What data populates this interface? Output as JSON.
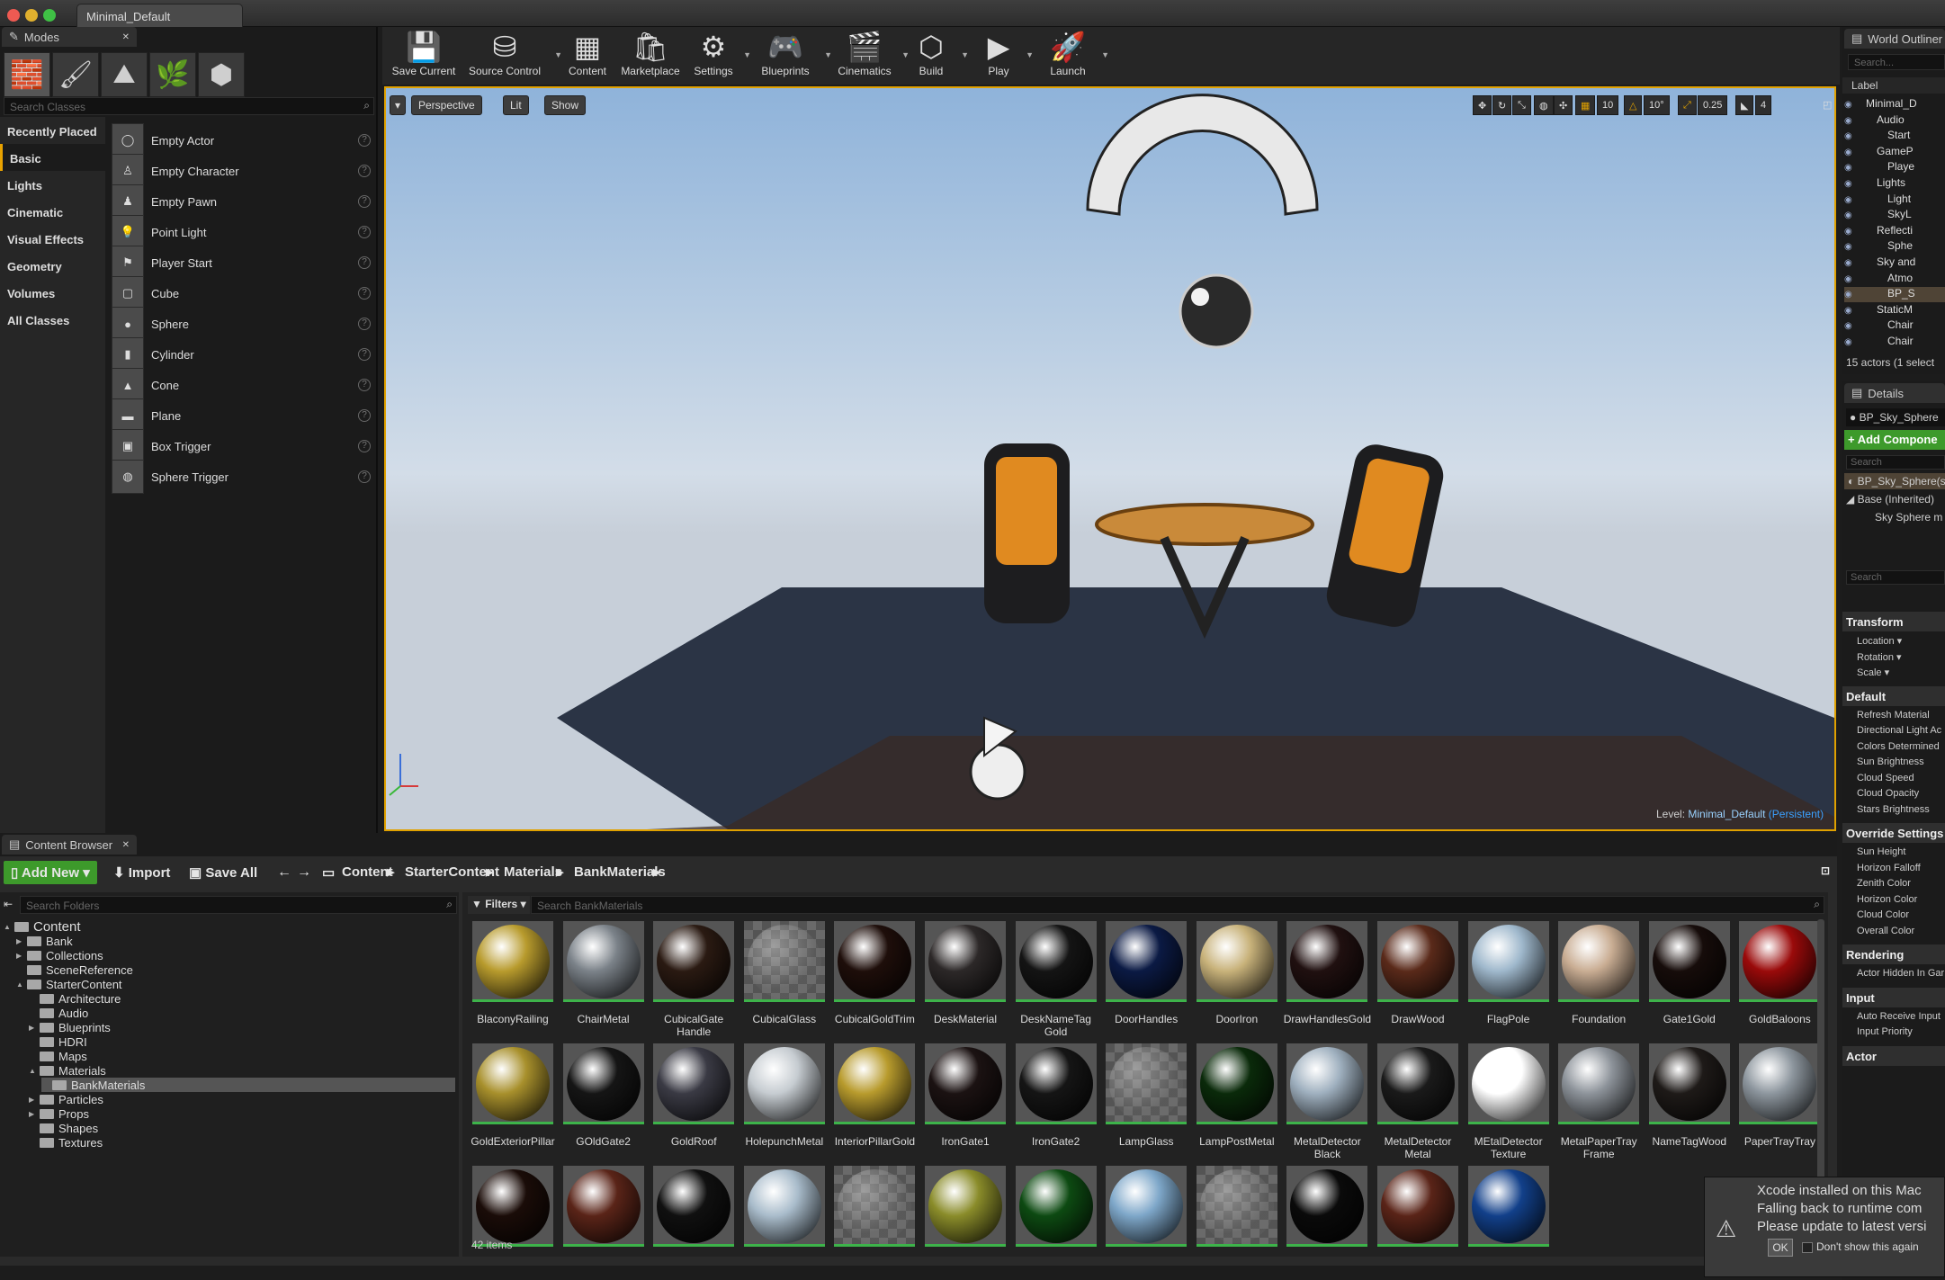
{
  "window": {
    "title": "Minimal_Default"
  },
  "modes": {
    "tab_label": "Modes",
    "search_placeholder": "Search Classes",
    "categories": [
      "Recently Placed",
      "Basic",
      "Lights",
      "Cinematic",
      "Visual Effects",
      "Geometry",
      "Volumes",
      "All Classes"
    ],
    "active_category": "Basic",
    "items": [
      "Empty Actor",
      "Empty Character",
      "Empty Pawn",
      "Point Light",
      "Player Start",
      "Cube",
      "Sphere",
      "Cylinder",
      "Cone",
      "Plane",
      "Box Trigger",
      "Sphere Trigger"
    ]
  },
  "toolbar": {
    "buttons": [
      "Save Current",
      "Source Control",
      "Content",
      "Marketplace",
      "Settings",
      "Blueprints",
      "Cinematics",
      "Build",
      "Play",
      "Launch"
    ]
  },
  "viewport": {
    "perspective": "Perspective",
    "lit": "Lit",
    "show": "Show",
    "grid_snap": "10",
    "rot_snap": "10°",
    "scale_snap": "0.25",
    "cam_speed": "4",
    "level_label": "Level:",
    "level_name": "Minimal_Default",
    "level_suffix": "(Persistent)"
  },
  "content_browser": {
    "tab_label": "Content Browser",
    "add_new": "Add New",
    "import": "Import",
    "save_all": "Save All",
    "path": [
      "Content",
      "StarterContent",
      "Materials",
      "BankMaterials"
    ],
    "search_folders_placeholder": "Search Folders",
    "filters_label": "Filters",
    "search_assets_placeholder": "Search BankMaterials",
    "folders": [
      {
        "name": "Content",
        "depth": 0,
        "arrow": "▲"
      },
      {
        "name": "Bank",
        "depth": 1,
        "arrow": "▶"
      },
      {
        "name": "Collections",
        "depth": 1,
        "arrow": "▶"
      },
      {
        "name": "SceneReference",
        "depth": 1,
        "arrow": ""
      },
      {
        "name": "StarterContent",
        "depth": 1,
        "arrow": "▲"
      },
      {
        "name": "Architecture",
        "depth": 2,
        "arrow": ""
      },
      {
        "name": "Audio",
        "depth": 2,
        "arrow": ""
      },
      {
        "name": "Blueprints",
        "depth": 2,
        "arrow": "▶"
      },
      {
        "name": "HDRI",
        "depth": 2,
        "arrow": ""
      },
      {
        "name": "Maps",
        "depth": 2,
        "arrow": ""
      },
      {
        "name": "Materials",
        "depth": 2,
        "arrow": "▲"
      },
      {
        "name": "BankMaterials",
        "depth": 3,
        "arrow": ""
      },
      {
        "name": "Particles",
        "depth": 2,
        "arrow": "▶"
      },
      {
        "name": "Props",
        "depth": 2,
        "arrow": "▶"
      },
      {
        "name": "Shapes",
        "depth": 2,
        "arrow": ""
      },
      {
        "name": "Textures",
        "depth": 2,
        "arrow": ""
      }
    ],
    "assets": [
      {
        "name": "BlaconyRailing",
        "color": "#b89b2d"
      },
      {
        "name": "ChairMetal",
        "color": "#7b8289"
      },
      {
        "name": "CubicalGate Handle",
        "color": "#2a1a12"
      },
      {
        "name": "CubicalGlass",
        "color": "checker"
      },
      {
        "name": "CubicalGoldTrim",
        "color": "#1e0e0a"
      },
      {
        "name": "DeskMaterial",
        "color": "#2c2828"
      },
      {
        "name": "DeskNameTag Gold",
        "color": "#141414"
      },
      {
        "name": "DoorHandles",
        "color": "#0b1a44"
      },
      {
        "name": "DoorIron",
        "color": "#c8b27a"
      },
      {
        "name": "DrawHandlesGold",
        "color": "#201010"
      },
      {
        "name": "DrawWood",
        "color": "#5a2a1a"
      },
      {
        "name": "FlagPole",
        "color": "#9fb8cc"
      },
      {
        "name": "Foundation",
        "color": "#c9ad93"
      },
      {
        "name": "Gate1Gold",
        "color": "#160c0a"
      },
      {
        "name": "GoldBaloons",
        "color": "#9a0a0a"
      },
      {
        "name": "GoldExteriorPillar",
        "color": "#a8902c"
      },
      {
        "name": "GOldGate2",
        "color": "#151515"
      },
      {
        "name": "GoldRoof",
        "color": "#3a3a44"
      },
      {
        "name": "HolepunchMetal",
        "color": "#c6ccd1"
      },
      {
        "name": "InteriorPillarGold",
        "color": "#b89b2d"
      },
      {
        "name": "IronGate1",
        "color": "#1b1212"
      },
      {
        "name": "IronGate2",
        "color": "#151515"
      },
      {
        "name": "LampGlass",
        "color": "checker"
      },
      {
        "name": "LampPostMetal",
        "color": "#0a2a0a"
      },
      {
        "name": "MetalDetector Black",
        "color": "#9fb0bf"
      },
      {
        "name": "MetalDetector Metal",
        "color": "#1a1a1a"
      },
      {
        "name": "MEtalDetector Texture",
        "color": "#ffffff"
      },
      {
        "name": "MetalPaperTray Frame",
        "color": "#8d939a"
      },
      {
        "name": "NameTagWood",
        "color": "#1e1a18"
      },
      {
        "name": "PaperTrayTray",
        "color": "#8d969e"
      },
      {
        "name": "",
        "color": "#1a0c08"
      },
      {
        "name": "",
        "color": "#5a2418"
      },
      {
        "name": "",
        "color": "#101010"
      },
      {
        "name": "",
        "color": "#a9bccb"
      },
      {
        "name": "",
        "color": "checker"
      },
      {
        "name": "",
        "color": "#8a8c2a"
      },
      {
        "name": "",
        "color": "#0d4a12"
      },
      {
        "name": "",
        "color": "#7ea7c9"
      },
      {
        "name": "",
        "color": "checker"
      },
      {
        "name": "",
        "color": "#0a0a0a"
      },
      {
        "name": "",
        "color": "#5a2418"
      },
      {
        "name": "",
        "color": "#12408a"
      }
    ],
    "item_count": "42 items"
  },
  "outliner": {
    "tab_label": "World Outliner",
    "search_placeholder": "Search...",
    "label_header": "Label",
    "rows": [
      {
        "label": "Minimal_D",
        "indent": 1
      },
      {
        "label": "Audio",
        "indent": 2
      },
      {
        "label": "Start",
        "indent": 3
      },
      {
        "label": "GameP",
        "indent": 2
      },
      {
        "label": "Playe",
        "indent": 3
      },
      {
        "label": "Lights",
        "indent": 2
      },
      {
        "label": "Light",
        "indent": 3
      },
      {
        "label": "SkyL",
        "indent": 3
      },
      {
        "label": "Reflecti",
        "indent": 2
      },
      {
        "label": "Sphe",
        "indent": 3
      },
      {
        "label": "Sky and",
        "indent": 2
      },
      {
        "label": "Atmo",
        "indent": 3
      },
      {
        "label": "BP_S",
        "indent": 3
      },
      {
        "label": "StaticM",
        "indent": 2
      },
      {
        "label": "Chair",
        "indent": 3
      },
      {
        "label": "Chair",
        "indent": 3
      }
    ],
    "footer": "15 actors (1 select"
  },
  "details": {
    "tab_label": "Details",
    "actor_name": "BP_Sky_Sphere",
    "add_component": "+ Add Compone",
    "search_placeholder": "Search",
    "component_root": "BP_Sky_Sphere(s",
    "base_label": "Base (Inherited)",
    "sky_sphere_mesh": "Sky Sphere m",
    "search2_placeholder": "Search",
    "sections": [
      {
        "title": "Transform",
        "rows": [
          "Location ▾",
          "Rotation ▾",
          "Scale ▾"
        ]
      },
      {
        "title": "Default",
        "rows": [
          "Refresh Material",
          "Directional Light Ac",
          "Colors Determined",
          "Sun Brightness",
          "Cloud Speed",
          "Cloud Opacity",
          "Stars Brightness"
        ]
      },
      {
        "title": "Override Settings",
        "rows": [
          "Sun Height",
          "Horizon Falloff",
          "Zenith Color",
          "Horizon Color",
          "Cloud Color",
          "Overall Color"
        ]
      },
      {
        "title": "Rendering",
        "rows": [
          "Actor Hidden In Gar"
        ]
      },
      {
        "title": "Input",
        "rows": [
          "Auto Receive Input",
          "Input Priority"
        ]
      },
      {
        "title": "Actor",
        "rows": []
      }
    ]
  },
  "notification": {
    "line1": "Xcode installed on this Mac",
    "line2": "Falling back to runtime com",
    "line3": "Please update to latest versi",
    "ok": "OK",
    "dont_show": "Don't show this again"
  },
  "colors": {
    "accent": "#e0a100",
    "add_new_green": "#3d9a2b",
    "selection": "#4f4436"
  }
}
